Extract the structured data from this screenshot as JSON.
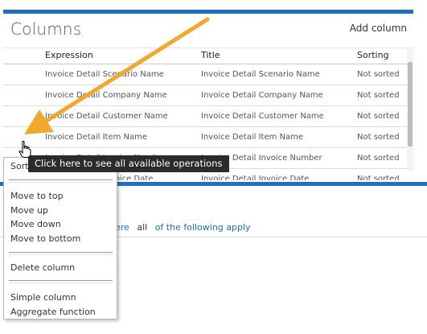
{
  "columns_panel": {
    "title": "Columns",
    "add_column": "Add column",
    "headers": {
      "expression": "Expression",
      "title": "Title",
      "sorting": "Sorting"
    },
    "rows": [
      {
        "expression": "Invoice Detail Scenario Name",
        "title": "Invoice Detail Scenario Name",
        "sorting": "Not sorted"
      },
      {
        "expression": "Invoice Detail Company Name",
        "title": "Invoice Detail Company Name",
        "sorting": "Not sorted"
      },
      {
        "expression": "Invoice Detail Customer Name",
        "title": "Invoice Detail Customer Name",
        "sorting": "Not sorted"
      },
      {
        "expression": "Invoice Detail Item Name",
        "title": "Invoice Detail Item Name",
        "sorting": "Not sorted"
      },
      {
        "expression": "Invoice Detail Invoice Number",
        "title": "Invoice Detail Invoice Number",
        "sorting": "Not sorted"
      },
      {
        "expression": "Invoice Detail Invoice Date",
        "title": "Invoice Detail Invoice Date",
        "sorting": "Not sorted"
      }
    ]
  },
  "filter_panel": {
    "where_label": "ere",
    "quantifier": "all",
    "condition_label": "of the following apply"
  },
  "context_menu": {
    "sort": "Sort",
    "move_to_top": "Move to top",
    "move_up": "Move up",
    "move_down": "Move down",
    "move_to_bottom": "Move to bottom",
    "delete_column": "Delete column",
    "simple_column": "Simple column",
    "aggregate_function": "Aggregate function"
  },
  "tooltip": {
    "text": "Click here to see all available operations"
  },
  "colors": {
    "accent": "#1f6fbf",
    "annotation_arrow": "#f0a92c",
    "tooltip_bg": "#2b2b2b"
  },
  "icons": {
    "cursor": "hand-pointer-icon",
    "annotation": "arrow-icon"
  }
}
